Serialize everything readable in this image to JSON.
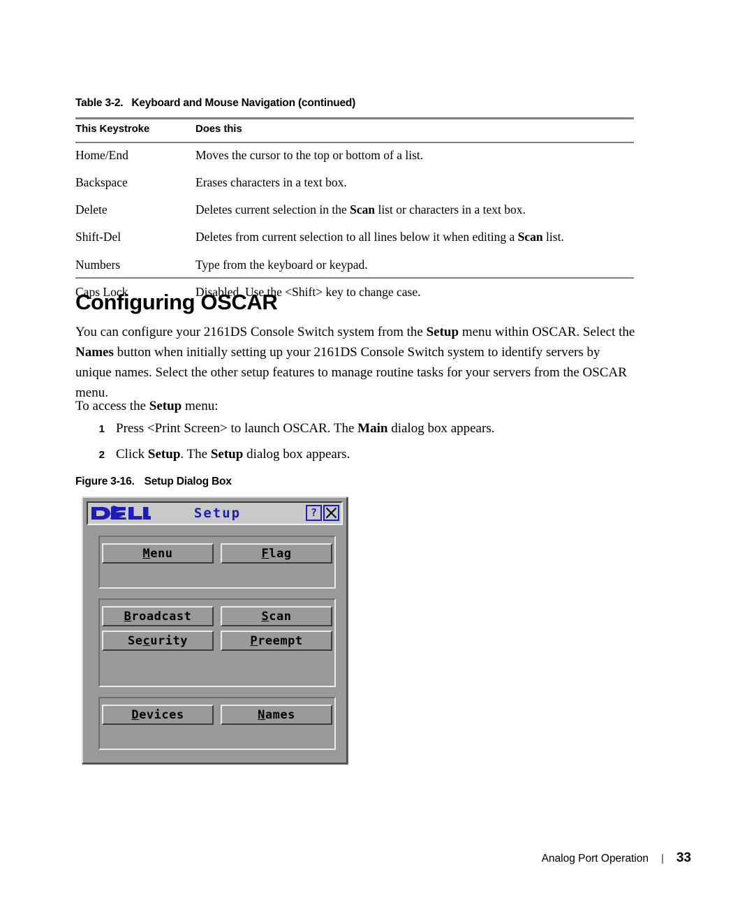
{
  "table": {
    "caption_number": "Table 3-2.",
    "caption_text": "Keyboard and Mouse Navigation (continued)",
    "headers": [
      "This Keystroke",
      "Does this"
    ],
    "rows": [
      {
        "key": "Home/End",
        "pre": "Moves the cursor to the top or bottom of a list.",
        "bold": "",
        "post": ""
      },
      {
        "key": "Backspace",
        "pre": "Erases characters in a text box.",
        "bold": "",
        "post": ""
      },
      {
        "key": "Delete",
        "pre": "Deletes current selection in the ",
        "bold": "Scan",
        "post": " list or characters in a text box."
      },
      {
        "key": "Shift-Del",
        "pre": "Deletes from current selection to all lines below it when editing a ",
        "bold": "Scan",
        "post": " list."
      },
      {
        "key": "Numbers",
        "pre": "Type from the keyboard or keypad.",
        "bold": "",
        "post": ""
      },
      {
        "key": "Caps Lock",
        "pre": "Disabled. Use the <Shift> key to change case.",
        "bold": "",
        "post": ""
      }
    ]
  },
  "section": {
    "heading": "Configuring OSCAR",
    "paragraph": {
      "p1": "You can configure your 2161DS Console Switch system from the ",
      "b1": "Setup",
      "p2": " menu within OSCAR. Select the ",
      "b2": "Names",
      "p3": " button when initially setting up your 2161DS Console Switch system to identify servers by unique names. Select the other setup features to manage routine tasks for your servers from the OSCAR menu."
    },
    "lead": {
      "l1": "To access the ",
      "b1": "Setup",
      "l2": " menu:"
    },
    "steps": [
      {
        "num": "1",
        "pre": "Press <Print Screen> to launch OSCAR. The ",
        "bold": "Main",
        "post": " dialog box appears."
      },
      {
        "num": "2",
        "pre": "Click ",
        "bold": "Setup",
        "post": ". The ",
        "bold2": "Setup",
        "post2": " dialog box appears."
      }
    ]
  },
  "figure": {
    "caption_number": "Figure 3-16.",
    "caption_text": "Setup Dialog Box"
  },
  "dialog": {
    "brand": "DELL",
    "title": "Setup",
    "help_label": "?",
    "close_label": "X",
    "groups": [
      {
        "rows": [
          [
            {
              "label": "Menu",
              "accel_index": 0
            },
            {
              "label": "Flag",
              "accel_index": 0
            }
          ]
        ]
      },
      {
        "rows": [
          [
            {
              "label": "Broadcast",
              "accel_index": 0
            },
            {
              "label": "Scan",
              "accel_index": 0
            }
          ],
          [
            {
              "label": "Security",
              "accel_index": 2
            },
            {
              "label": "Preempt",
              "accel_index": 0
            }
          ]
        ]
      },
      {
        "rows": [
          [
            {
              "label": "Devices",
              "accel_index": 0
            },
            {
              "label": "Names",
              "accel_index": 0
            }
          ]
        ]
      }
    ],
    "colors": {
      "face": "#9a9a9a",
      "titlebar": "#c9c9c9",
      "brand_blue": "#1d1dbe"
    }
  },
  "footer": {
    "label": "Analog Port Operation",
    "separator": "|",
    "page": "33"
  }
}
